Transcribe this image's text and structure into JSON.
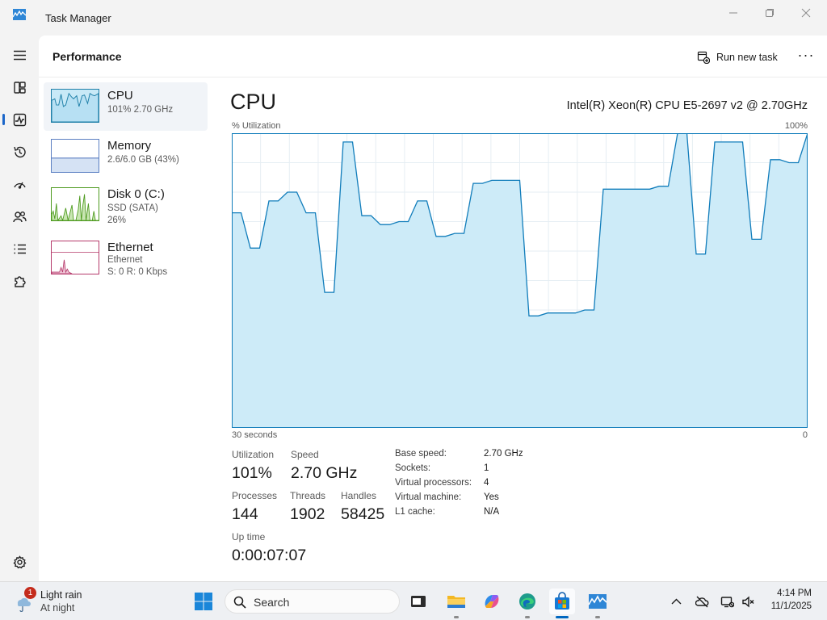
{
  "window": {
    "title": "Task Manager"
  },
  "nav": {
    "items": [
      "menu",
      "processes",
      "performance",
      "app-history",
      "startup-apps",
      "users",
      "details",
      "services",
      "settings"
    ]
  },
  "header": {
    "title": "Performance",
    "run_task": "Run new task",
    "more": "···"
  },
  "sidebar": {
    "items": [
      {
        "name": "CPU",
        "sub1": "101% 2.70 GHz",
        "sub2": "",
        "sub3": "",
        "color": "#1e7fa8",
        "fill": "#c8e9f7"
      },
      {
        "name": "Memory",
        "sub1": "2.6/6.0 GB (43%)",
        "sub2": "",
        "sub3": "",
        "color": "#5b7fc2",
        "fill": "#d5e2f4",
        "level": 0.43
      },
      {
        "name": "Disk 0 (C:)",
        "sub1": "SSD (SATA)",
        "sub2": "26%",
        "sub3": "",
        "color": "#4d9a1e",
        "fill": "#d9eec9"
      },
      {
        "name": "Ethernet",
        "sub1": "Ethernet",
        "sub2": "S: 0 R: 0 Kbps",
        "sub3": "",
        "color": "#b53a6b",
        "fill": "#f4d7e3"
      }
    ]
  },
  "cpu": {
    "title": "CPU",
    "model": "Intel(R) Xeon(R) CPU E5-2697 v2 @ 2.70GHz",
    "y_label": "% Utilization",
    "y_max_label": "100%",
    "x_left_label": "30 seconds",
    "x_right_label": "0"
  },
  "chart_data": {
    "type": "area",
    "title": "",
    "xlabel": "",
    "ylabel": "% Utilization",
    "x_range_seconds": [
      30,
      0
    ],
    "ylim": [
      0,
      100
    ],
    "grid": true,
    "line_color": "#117dbb",
    "fill_color": "#cdebf8",
    "values": [
      73,
      73,
      61,
      61,
      77,
      77,
      80,
      80,
      73,
      73,
      46,
      46,
      97,
      97,
      72,
      72,
      69,
      69,
      70,
      70,
      77,
      77,
      65,
      65,
      66,
      66,
      83,
      83,
      84,
      84,
      84,
      84,
      38,
      38,
      39,
      39,
      39,
      39,
      40,
      40,
      81,
      81,
      81,
      81,
      81,
      81,
      82,
      82,
      100,
      100,
      59,
      59,
      97,
      97,
      97,
      97,
      64,
      64,
      91,
      91,
      90,
      90,
      100
    ]
  },
  "stats": {
    "utilization_label": "Utilization",
    "utilization": "101%",
    "speed_label": "Speed",
    "speed": "2.70 GHz",
    "processes_label": "Processes",
    "processes": "144",
    "threads_label": "Threads",
    "threads": "1902",
    "handles_label": "Handles",
    "handles": "58425",
    "uptime_label": "Up time",
    "uptime": "0:00:07:07"
  },
  "details": [
    {
      "label": "Base speed:",
      "value": "2.70 GHz"
    },
    {
      "label": "Sockets:",
      "value": "1"
    },
    {
      "label": "Virtual processors:",
      "value": "4"
    },
    {
      "label": "Virtual machine:",
      "value": "Yes"
    },
    {
      "label": "L1 cache:",
      "value": "N/A"
    }
  ],
  "taskbar": {
    "weather_line1": "Light rain",
    "weather_line2": "At night",
    "weather_badge": "1",
    "search_placeholder": "Search",
    "time": "4:14 PM",
    "date": "11/1/2025"
  }
}
